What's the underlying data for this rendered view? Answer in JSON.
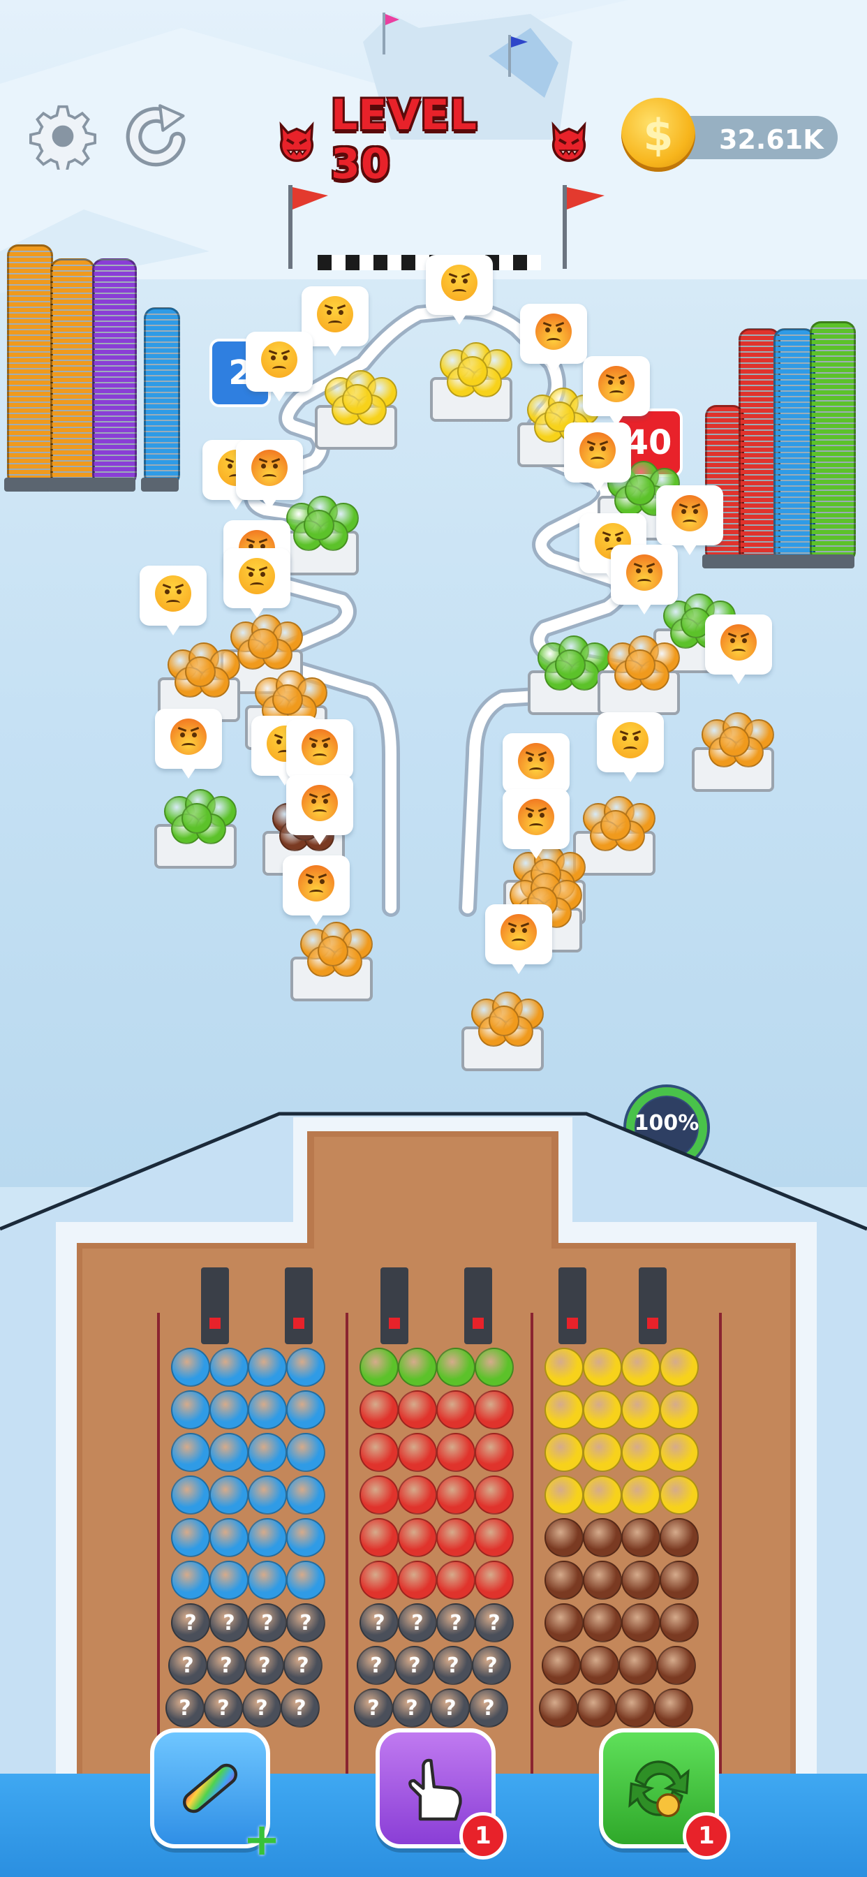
{
  "hud": {
    "settings_icon": "gear-icon",
    "restart_icon": "restart-icon",
    "level_label": "LEVEL 30",
    "coins": "32.61K",
    "coin_symbol": "$"
  },
  "progress": {
    "label": "100%",
    "value": 1.0
  },
  "signs": {
    "left": "2",
    "right": "40"
  },
  "colors": {
    "blue": "#2f9be6",
    "green": "#5cc22a",
    "red": "#e0332c",
    "yellow": "#f7d21b",
    "brown": "#7a3a22",
    "orange": "#f09a1d",
    "purple": "#8a3ed6",
    "gray": "#4a4f5a",
    "accent_red": "#e8222a"
  },
  "lanes": [
    {
      "name": "left",
      "rows": [
        "blue",
        "blue",
        "blue",
        "blue",
        "blue",
        "blue",
        "unknown",
        "unknown",
        "unknown"
      ]
    },
    {
      "name": "middle",
      "rows": [
        "green",
        "red",
        "red",
        "red",
        "red",
        "red",
        "unknown",
        "unknown",
        "unknown"
      ]
    },
    {
      "name": "right",
      "rows": [
        "yellow",
        "yellow",
        "yellow",
        "yellow",
        "brown",
        "brown",
        "brown",
        "brown",
        "brown"
      ]
    }
  ],
  "unknown_mark": "?",
  "boosters": [
    {
      "name": "skateboard-booster",
      "icon": "skateboard-icon",
      "badge": "+"
    },
    {
      "name": "pointer-booster",
      "icon": "pointing-hand-icon",
      "badge": "1"
    },
    {
      "name": "swap-booster",
      "icon": "swap-icon",
      "badge": "1"
    }
  ]
}
